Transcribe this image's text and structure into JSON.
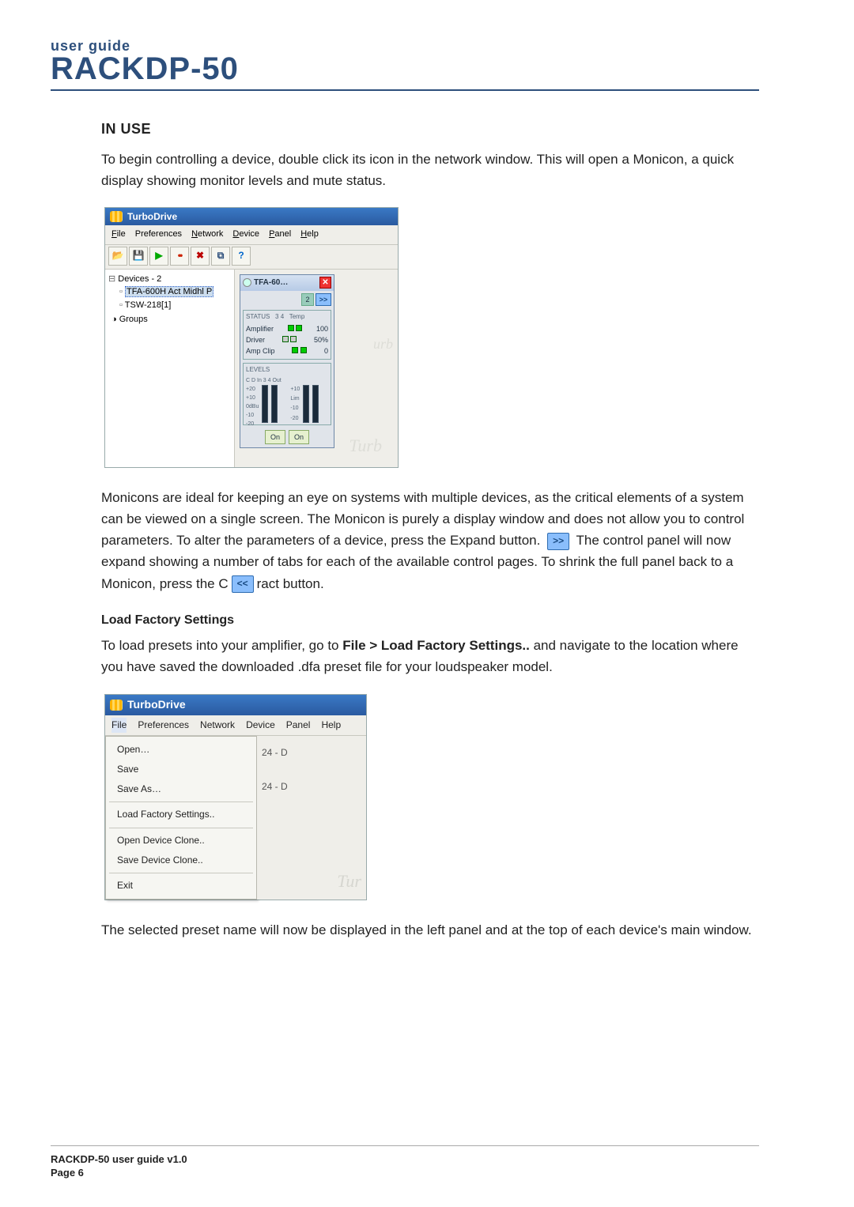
{
  "header": {
    "small": "user guide",
    "big": "RACKDP-50"
  },
  "section": {
    "in_use": "IN USE"
  },
  "paras": {
    "intro": "To begin controlling a device, double click its icon in the network window. This will open a Monicon, a quick display showing monitor levels and mute status.",
    "monicons": "Monicons are ideal for keeping an eye on systems with multiple devices, as the critical elements of a system can be viewed on a single screen. The Monicon is purely a display window and does not allow you to control parameters. To alter the parameters of a device, press the Expand button.",
    "monicons_after": " The control panel will now expand showing a number of tabs for each of the available control pages. To shrink the full panel back to a Monicon, press the             C",
    "monicons_tail": "ract button.",
    "load_title": "Load Factory Settings",
    "load_a": "To load presets into your amplifier, go to ",
    "load_bold": "File > Load Factory Settings..",
    "load_b": " and navigate to the location where you have saved the downloaded .dfa preset file for your loudspeaker model.",
    "selected": "The selected preset name will now be displayed in the left panel and at the top of each device's main window."
  },
  "expand_icon": ">>",
  "contract_icon": "<<",
  "app": {
    "title": "TurboDrive",
    "menus": {
      "file": "File",
      "prefs": "Preferences",
      "network": "Network",
      "device": "Device",
      "panel": "Panel",
      "help": "Help"
    },
    "toolbar_icons": {
      "open": "📂",
      "save": "💾",
      "play": "▶",
      "dots": "••",
      "x": "✖",
      "layers": "⧉",
      "help": "?"
    },
    "tree": {
      "root": "Devices - 2",
      "items": [
        "TFA-600H Act Midhl P",
        "TSW-218[1]"
      ],
      "groups": "Groups"
    },
    "monicon": {
      "title": "TFA-60…",
      "nav_num": "2",
      "expand": ">>",
      "status": {
        "label": "STATUS",
        "ch34": "3  4",
        "temp_label": "Temp",
        "amp": "Amplifier",
        "driver": "Driver",
        "clip": "Amp Clip",
        "temp_scale": [
          "100",
          "50%",
          "0"
        ]
      },
      "levels": {
        "label": "LEVELS",
        "chans": "C D In     3     4 Out",
        "in_scale": [
          "+20",
          "+10",
          "0dBu",
          "-10",
          "-20"
        ],
        "out_scale": [
          "+10",
          "Lim",
          "-10",
          "-20"
        ]
      },
      "on": "On"
    }
  },
  "menu2": {
    "items": [
      "Open…",
      "Save",
      "Save As…",
      "Load Factory Settings..",
      "Open Device Clone..",
      "Save Device Clone..",
      "Exit"
    ],
    "side_vals": [
      "24 - D",
      "24 - D"
    ]
  },
  "footer": {
    "line1": "RACKDP-50 user guide v1.0",
    "line2": "Page 6"
  }
}
